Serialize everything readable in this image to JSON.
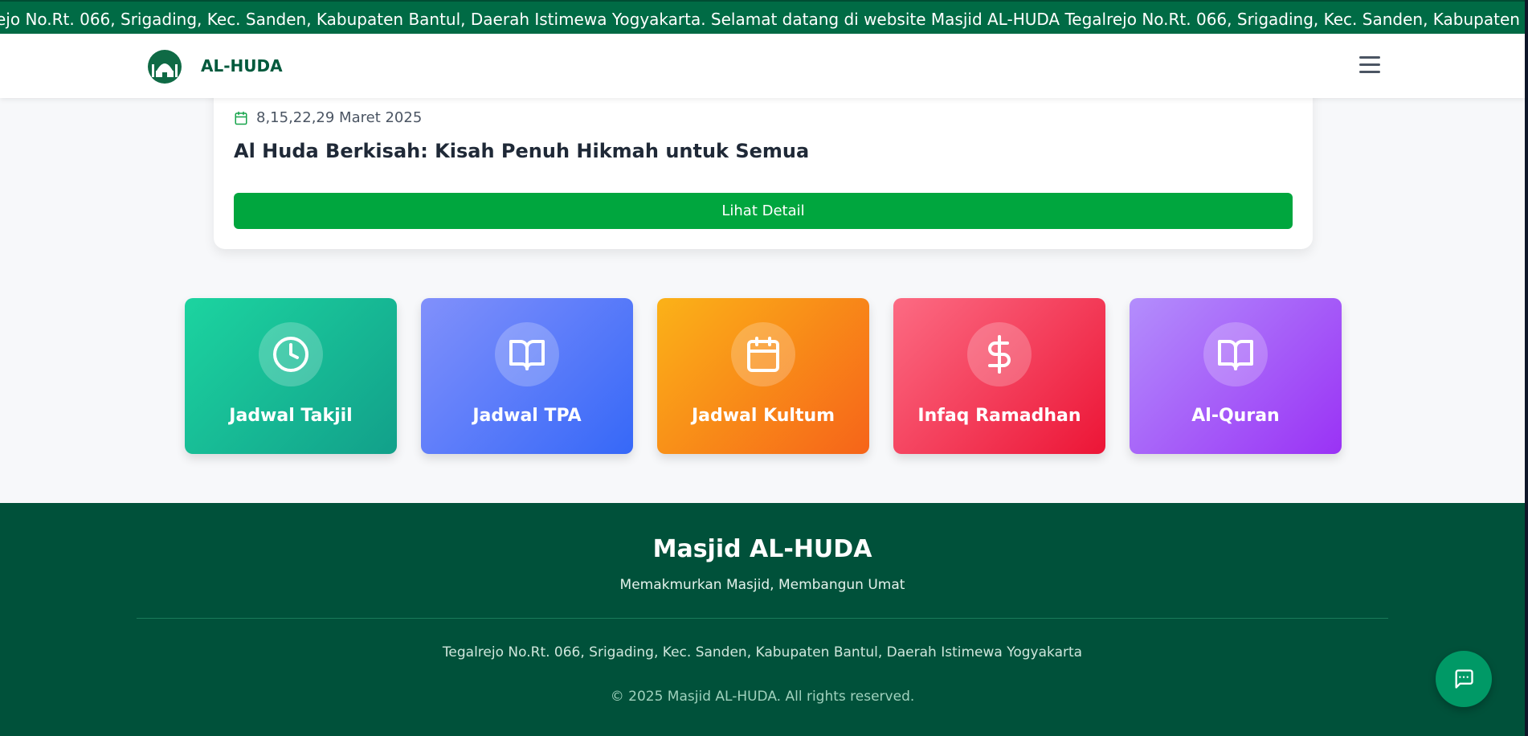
{
  "colors": {
    "marquee_bg": "#006b45",
    "brand": "#00593c",
    "primary_button": "#00a63e",
    "footer_bg": "#00513a",
    "chat_button": "#009966"
  },
  "announcement": {
    "text": "ejo No.Rt. 066, Srigading, Kec. Sanden, Kabupaten Bantul, Daerah Istimewa Yogyakarta.  Selamat datang di website Masjid AL-HUDA Tegalrejo No.Rt. 066, Srigading, Kec. Sanden, Kabupaten Bantul, Daerah Istimewa Yogya"
  },
  "navbar": {
    "brand_name": "AL-HUDA",
    "logo_icon": "mosque-logo-icon",
    "menu_icon": "hamburger-menu-icon"
  },
  "event": {
    "date_icon": "calendar-icon",
    "date": "8,15,22,29 Maret 2025",
    "title": "Al Huda Berkisah: Kisah Penuh Hikmah untuk Semua",
    "detail_button": "Lihat Detail"
  },
  "quick_links": [
    {
      "label": "Jadwal Takjil",
      "icon": "clock-icon"
    },
    {
      "label": "Jadwal TPA",
      "icon": "open-book-icon"
    },
    {
      "label": "Jadwal Kultum",
      "icon": "calendar-icon"
    },
    {
      "label": "Infaq Ramadhan",
      "icon": "dollar-icon"
    },
    {
      "label": "Al-Quran",
      "icon": "open-book-icon"
    }
  ],
  "footer": {
    "title": "Masjid AL-HUDA",
    "tagline": "Memakmurkan Masjid, Membangun Umat",
    "address": "Tegalrejo No.Rt. 066, Srigading, Kec. Sanden, Kabupaten Bantul, Daerah Istimewa Yogyakarta",
    "copyright": "© 2025 Masjid AL-HUDA. All rights reserved."
  },
  "chat": {
    "icon": "chat-bubble-icon"
  }
}
